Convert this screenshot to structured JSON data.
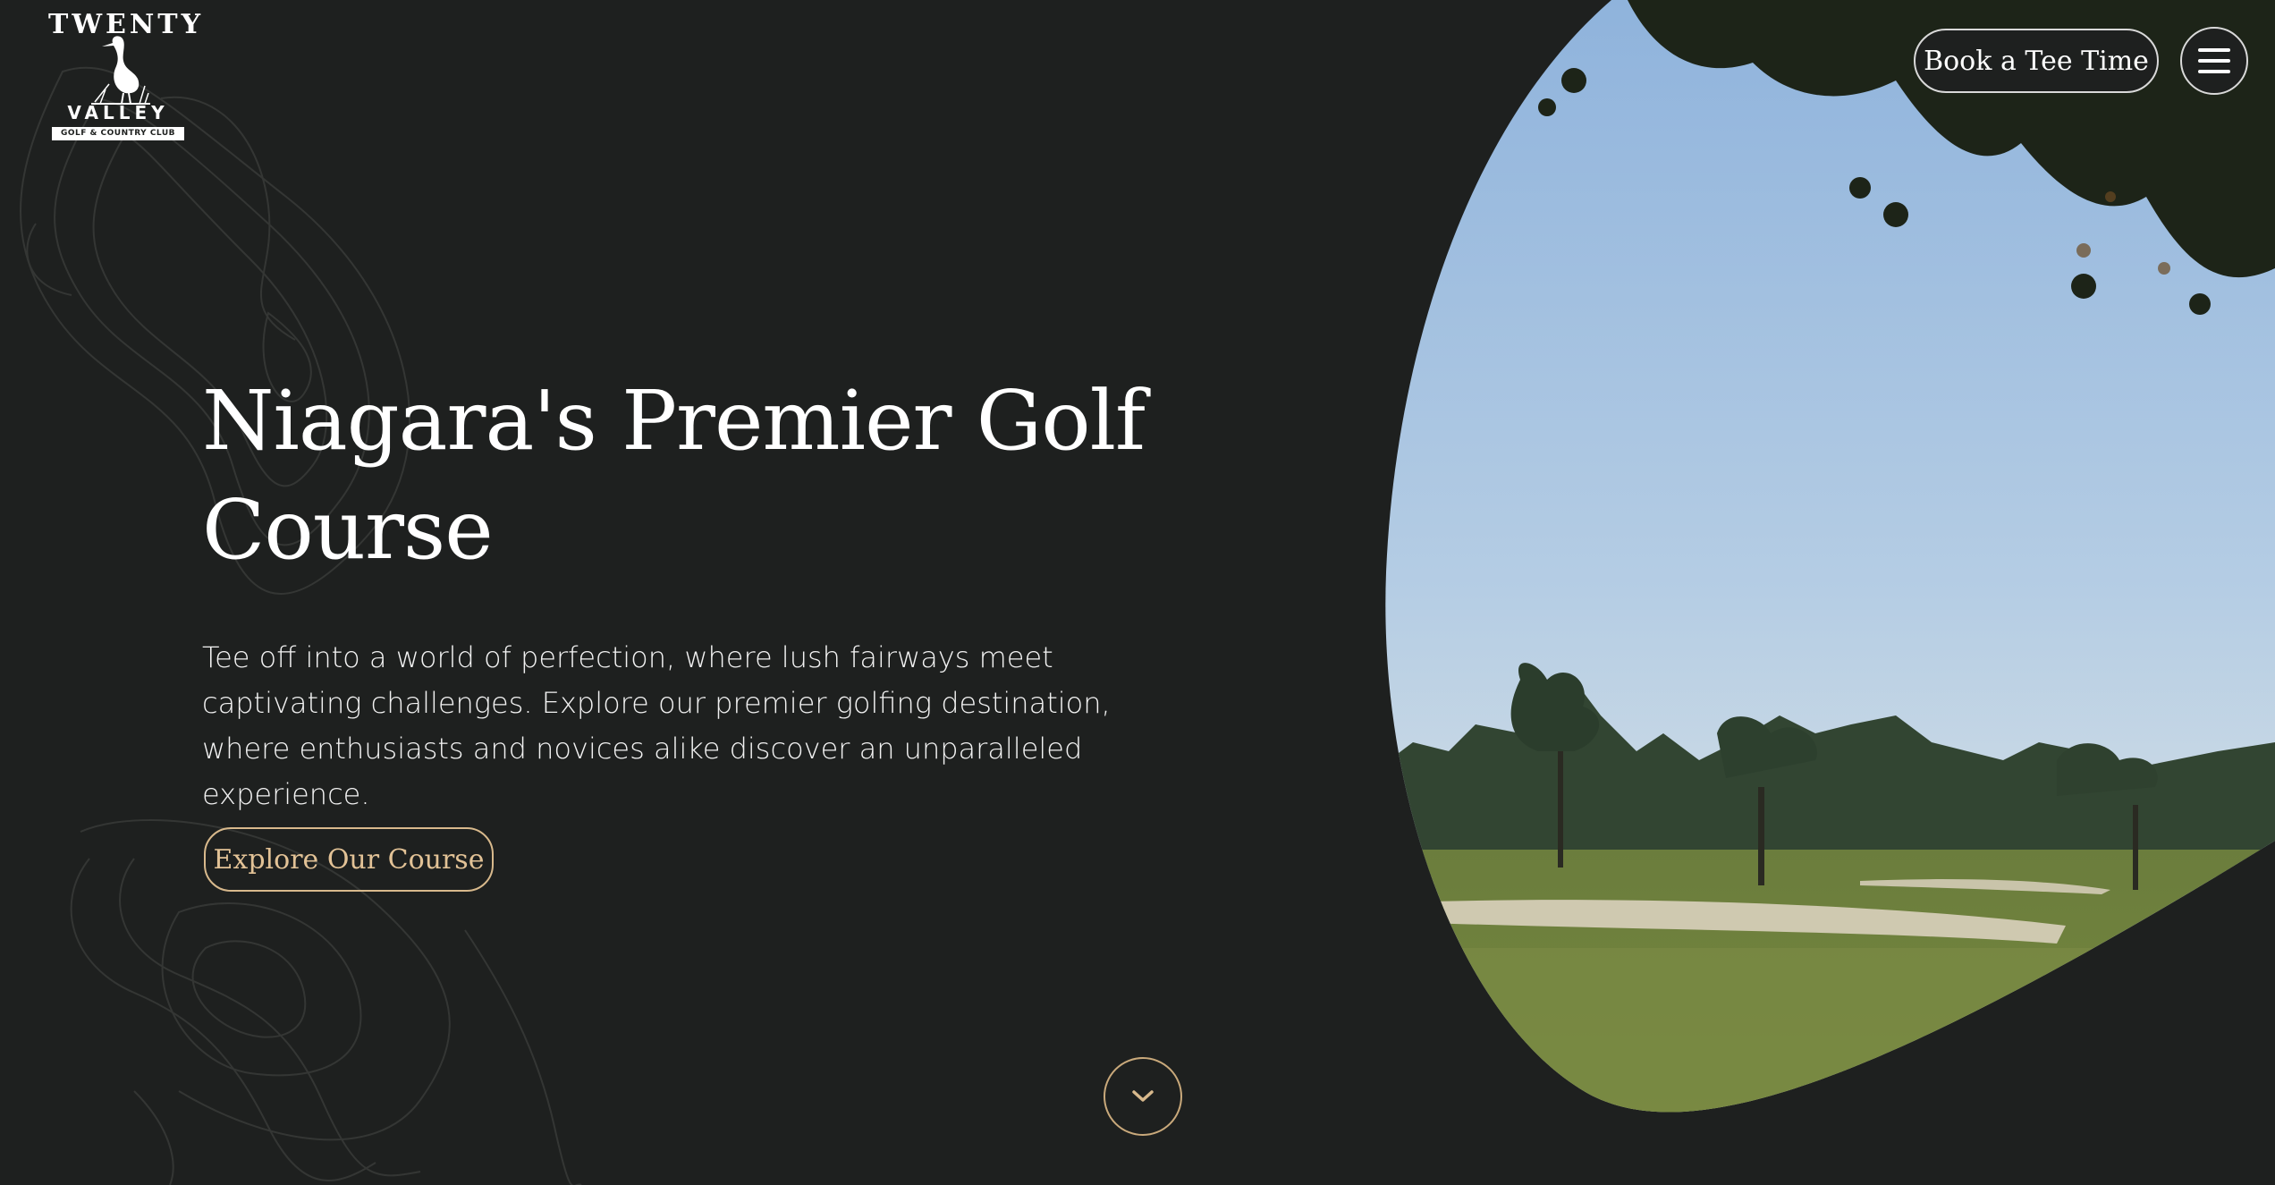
{
  "brand": {
    "logo_top": "TWENTY",
    "logo_bottom": "VALLEY",
    "logo_sub": "GOLF & COUNTRY CLUB"
  },
  "header": {
    "book_label": "Book a Tee Time",
    "menu_icon": "hamburger-menu-icon"
  },
  "hero": {
    "title": "Niagara's Premier Golf Course",
    "description": "Tee off into a world of perfection, where lush fairways meet captivating challenges. Explore our premier golfing destination, where enthusiasts and novices alike discover an unparalleled experience.",
    "cta_label": "Explore Our Course",
    "scroll_icon": "chevron-down-icon",
    "image": "golf-course-photo"
  },
  "colors": {
    "background": "#1e201f",
    "accent_gold": "#d8b98c",
    "text": "#ffffff"
  }
}
